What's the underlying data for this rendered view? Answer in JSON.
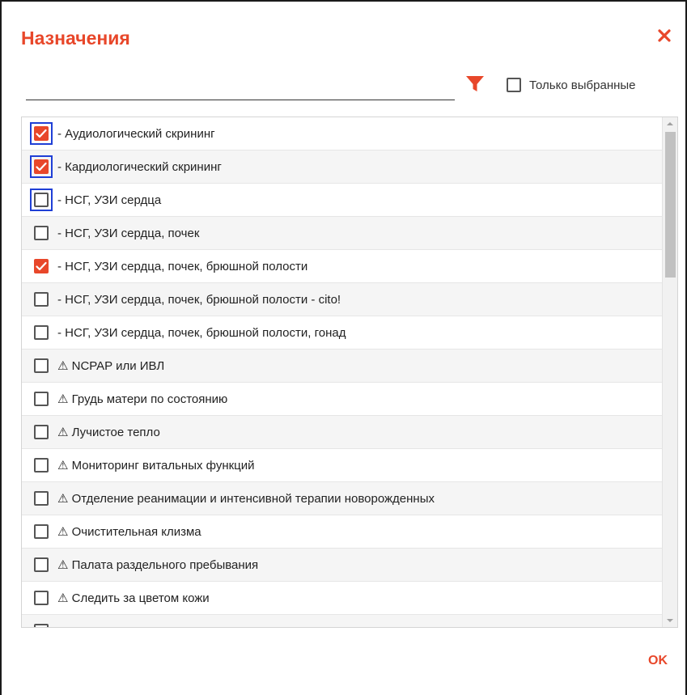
{
  "dialog": {
    "title": "Назначения",
    "search": {
      "value": "",
      "placeholder": ""
    },
    "only_selected": {
      "label": "Только выбранные",
      "checked": false
    },
    "ok_label": "OK",
    "accent_color": "#e8472a",
    "focus_color": "#1f3fd6"
  },
  "items": [
    {
      "label": "- Аудиологический скрининг",
      "checked": true,
      "focused": true
    },
    {
      "label": "- Кардиологический скрининг",
      "checked": true,
      "focused": true
    },
    {
      "label": "- НСГ, УЗИ сердца",
      "checked": false,
      "focused": true
    },
    {
      "label": "- НСГ, УЗИ сердца, почек",
      "checked": false,
      "focused": false
    },
    {
      "label": "- НСГ, УЗИ сердца, почек, брюшной полости",
      "checked": true,
      "focused": false
    },
    {
      "label": "- НСГ, УЗИ сердца, почек, брюшной полости - cito!",
      "checked": false,
      "focused": false
    },
    {
      "label": "- НСГ, УЗИ сердца, почек, брюшной полости, гонад",
      "checked": false,
      "focused": false
    },
    {
      "label": "⚠ NCPAP или ИВЛ",
      "checked": false,
      "focused": false
    },
    {
      "label": "⚠ Грудь матери по состоянию",
      "checked": false,
      "focused": false
    },
    {
      "label": "⚠ Лучистое тепло",
      "checked": false,
      "focused": false
    },
    {
      "label": "⚠ Мониторинг витальных функций",
      "checked": false,
      "focused": false
    },
    {
      "label": "⚠ Отделение реанимации и интенсивной терапии новорожденных",
      "checked": false,
      "focused": false
    },
    {
      "label": "⚠ Очистительная клизма",
      "checked": false,
      "focused": false
    },
    {
      "label": "⚠ Палата раздельного пребывания",
      "checked": false,
      "focused": false
    },
    {
      "label": "⚠ Следить за цветом кожи",
      "checked": false,
      "focused": false
    },
    {
      "label": "",
      "checked": false,
      "focused": false
    }
  ],
  "icons": {
    "close": "close-icon",
    "filter": "filter-icon",
    "check": "checkmark-icon",
    "scroll_up": "chevron-up-icon",
    "scroll_down": "chevron-down-icon"
  }
}
